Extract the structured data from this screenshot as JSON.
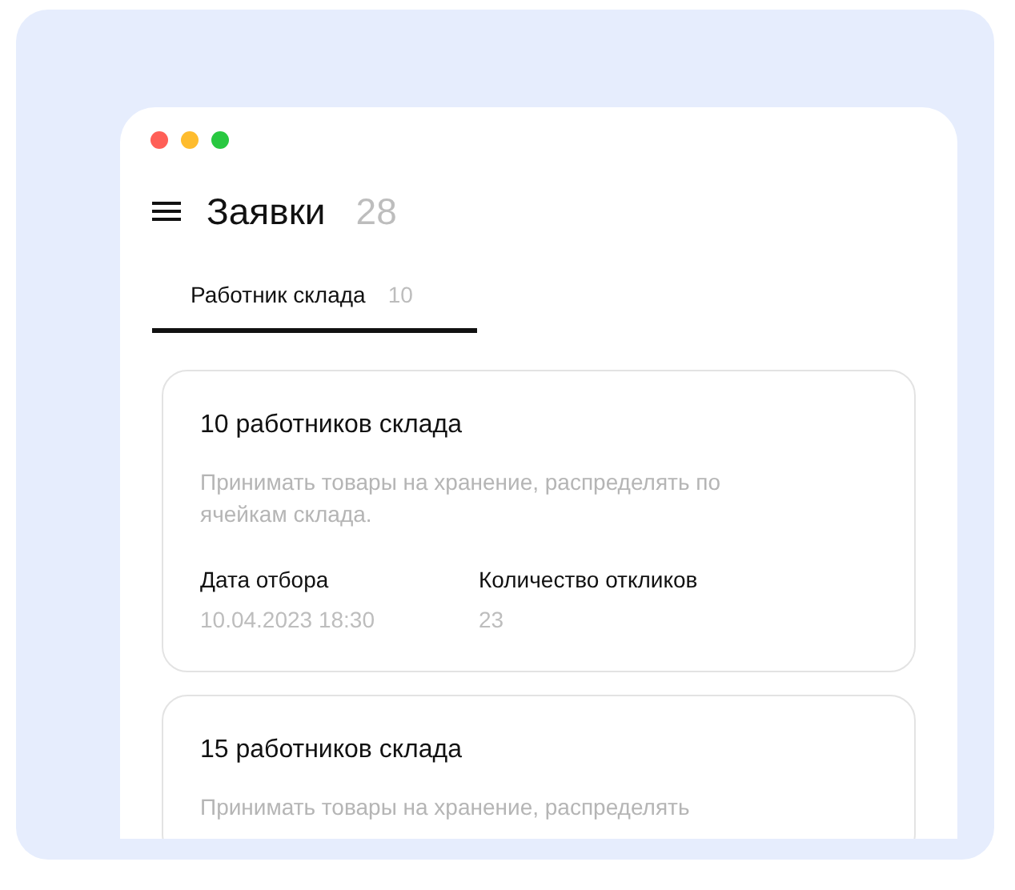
{
  "header": {
    "title": "Заявки",
    "count": "28"
  },
  "tabs": [
    {
      "label": "Работник склада",
      "count": "10",
      "selected": true
    }
  ],
  "cards": [
    {
      "title": "10 работников склада",
      "description": "Принимать товары на хранение, распределять по ячейкам склада.",
      "fields": [
        {
          "label": "Дата отбора",
          "value": "10.04.2023 18:30"
        },
        {
          "label": "Количество откликов",
          "value": "23"
        }
      ]
    },
    {
      "title": "15 работников склада",
      "description": "Принимать товары на хранение, распределять"
    }
  ]
}
